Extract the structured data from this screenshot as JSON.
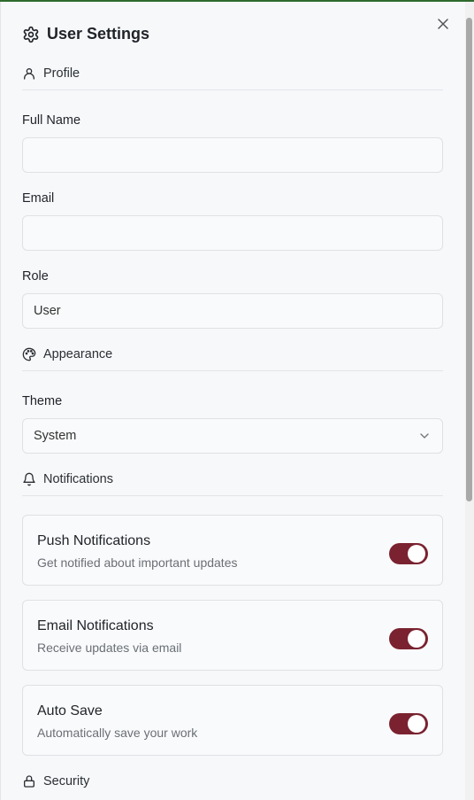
{
  "header": {
    "title": "User Settings",
    "icon": "gear-icon",
    "close_icon": "close-icon"
  },
  "sections": {
    "profile": {
      "label": "Profile",
      "icon": "user-icon",
      "fields": {
        "full_name": {
          "label": "Full Name",
          "value": ""
        },
        "email": {
          "label": "Email",
          "value": ""
        },
        "role": {
          "label": "Role",
          "value": "User"
        }
      }
    },
    "appearance": {
      "label": "Appearance",
      "icon": "palette-icon",
      "theme": {
        "label": "Theme",
        "value": "System"
      }
    },
    "notifications": {
      "label": "Notifications",
      "icon": "bell-icon",
      "items": [
        {
          "title": "Push Notifications",
          "description": "Get notified about important updates",
          "enabled": true
        },
        {
          "title": "Email Notifications",
          "description": "Receive updates via email",
          "enabled": true
        },
        {
          "title": "Auto Save",
          "description": "Automatically save your work",
          "enabled": true
        }
      ]
    },
    "security": {
      "label": "Security",
      "icon": "lock-icon"
    }
  },
  "colors": {
    "accent": "#7a2230",
    "top_bar": "#2e6b2e",
    "background": "#f7f8fa"
  }
}
